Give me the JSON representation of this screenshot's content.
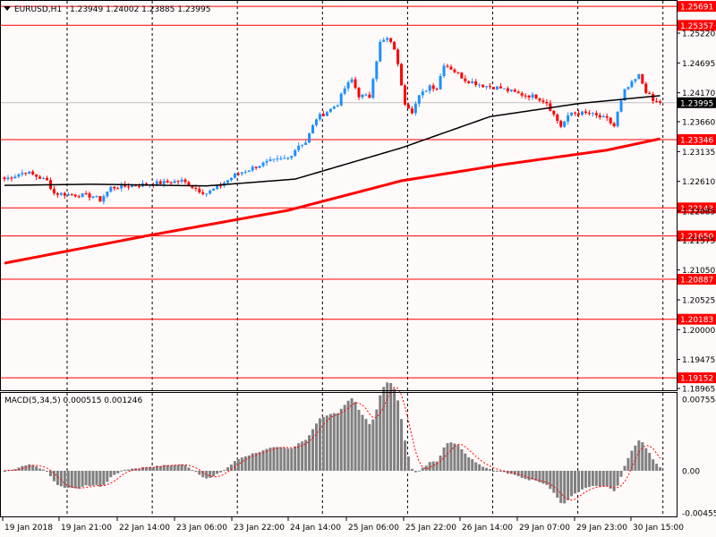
{
  "header": {
    "symbol": "EURUSD,H1",
    "ohlc": "1.23949 1.24002 1.23885 1.23995"
  },
  "macd_header": {
    "label": "MACD(5,34,5) 0.000515 0.001246"
  },
  "colors": {
    "bull": "#1e90ff",
    "bear": "#ff0000",
    "level": "#ff0000",
    "ma_slow": "#ff0000",
    "ma_fast": "#000000",
    "hist": "#808080"
  },
  "price_axis": {
    "ticks": [
      "1.25220",
      "1.24695",
      "1.24170",
      "1.23660",
      "1.23135",
      "1.22610",
      "1.22085",
      "1.21575",
      "1.21050",
      "1.20525",
      "1.20000",
      "1.19475",
      "1.18965"
    ]
  },
  "levels": [
    "1.25691",
    "1.25357",
    "1.23346",
    "1.22143",
    "1.21650",
    "1.20887",
    "1.20183",
    "1.19152"
  ],
  "current_price": "1.23995",
  "macd_axis": {
    "ticks": [
      "0.007554",
      "0.00",
      "-0.004555"
    ]
  },
  "time_axis": [
    "19 Jan 2018",
    "19 Jan 21:00",
    "22 Jan 14:00",
    "23 Jan 06:00",
    "23 Jan 22:00",
    "24 Jan 14:00",
    "25 Jan 06:00",
    "25 Jan 22:00",
    "26 Jan 14:00",
    "29 Jan 07:00",
    "29 Jan 23:00",
    "30 Jan 15:00"
  ],
  "chart_data": {
    "type": "candlestick",
    "close_anchors": [
      [
        0,
        1.2265
      ],
      [
        6,
        1.2278
      ],
      [
        12,
        1.2262
      ],
      [
        14,
        1.224
      ],
      [
        25,
        1.2235
      ],
      [
        27,
        1.2228
      ],
      [
        30,
        1.225
      ],
      [
        40,
        1.2256
      ],
      [
        50,
        1.2262
      ],
      [
        55,
        1.2245
      ],
      [
        57,
        1.224
      ],
      [
        60,
        1.225
      ],
      [
        65,
        1.2272
      ],
      [
        72,
        1.229
      ],
      [
        75,
        1.2296
      ],
      [
        80,
        1.2302
      ],
      [
        83,
        1.2325
      ],
      [
        85,
        1.233
      ],
      [
        88,
        1.2372
      ],
      [
        92,
        1.2388
      ],
      [
        94,
        1.2398
      ],
      [
        96,
        1.2425
      ],
      [
        98,
        1.244
      ],
      [
        100,
        1.2412
      ],
      [
        103,
        1.241
      ],
      [
        104,
        1.2445
      ],
      [
        106,
        1.2505
      ],
      [
        108,
        1.2512
      ],
      [
        110,
        1.2495
      ],
      [
        111,
        1.2465
      ],
      [
        113,
        1.24
      ],
      [
        115,
        1.2385
      ],
      [
        117,
        1.241
      ],
      [
        120,
        1.243
      ],
      [
        122,
        1.2425
      ],
      [
        124,
        1.2468
      ],
      [
        126,
        1.246
      ],
      [
        130,
        1.244
      ],
      [
        135,
        1.243
      ],
      [
        140,
        1.2425
      ],
      [
        145,
        1.2415
      ],
      [
        150,
        1.241
      ],
      [
        153,
        1.24
      ],
      [
        155,
        1.2378
      ],
      [
        157,
        1.2358
      ],
      [
        160,
        1.2382
      ],
      [
        165,
        1.238
      ],
      [
        170,
        1.237
      ],
      [
        172,
        1.2358
      ],
      [
        173,
        1.2382
      ],
      [
        175,
        1.242
      ],
      [
        178,
        1.244
      ],
      [
        179,
        1.2447
      ],
      [
        181,
        1.242
      ],
      [
        183,
        1.2402
      ],
      [
        185,
        1.23995
      ]
    ],
    "ma_fast_anchors": [
      [
        0,
        1.2254
      ],
      [
        25,
        1.2256
      ],
      [
        57,
        1.2253
      ],
      [
        82,
        1.2265
      ],
      [
        112,
        1.232
      ],
      [
        137,
        1.2375
      ],
      [
        162,
        1.2398
      ],
      [
        185,
        1.2412
      ]
    ],
    "ma_slow_anchors": [
      [
        0,
        1.2117
      ],
      [
        40,
        1.2165
      ],
      [
        80,
        1.221
      ],
      [
        112,
        1.2262
      ],
      [
        140,
        1.229
      ],
      [
        170,
        1.2316
      ],
      [
        185,
        1.2336
      ]
    ],
    "y_range": [
      1.18965,
      1.2522
    ]
  }
}
